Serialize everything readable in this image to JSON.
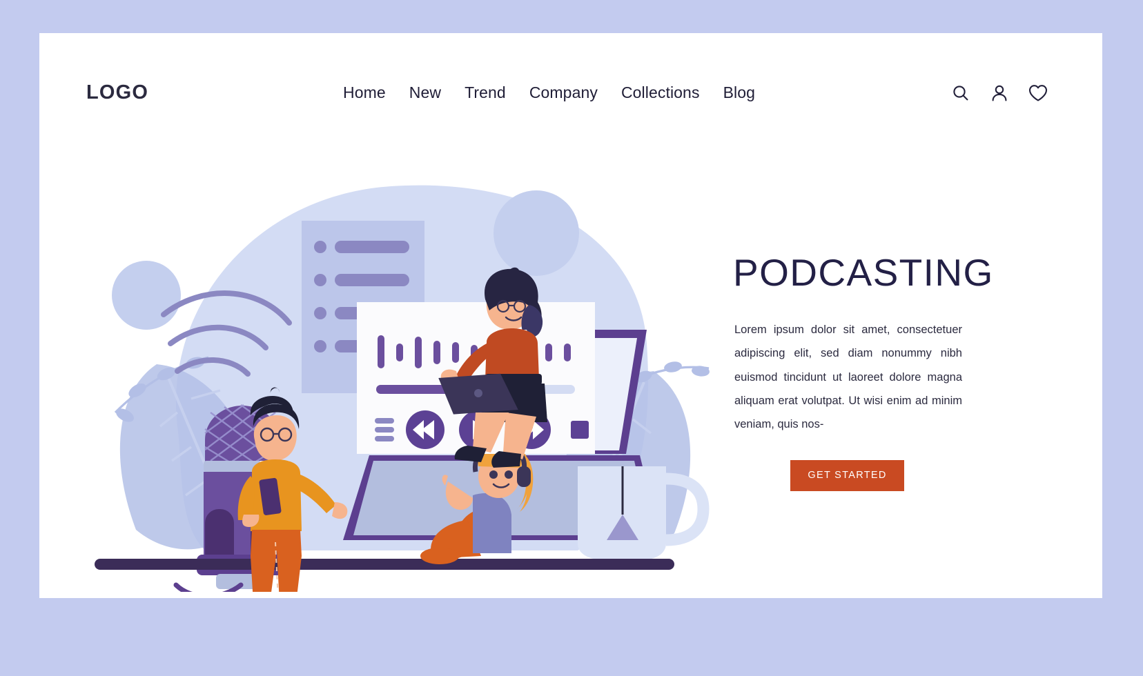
{
  "page": {
    "background_color": "#c3cbef",
    "card_color": "#ffffff"
  },
  "header": {
    "logo": "LOGO",
    "nav": [
      {
        "label": "Home"
      },
      {
        "label": "New"
      },
      {
        "label": "Trend"
      },
      {
        "label": "Company"
      },
      {
        "label": "Collections"
      },
      {
        "label": "Blog"
      }
    ],
    "icons": [
      {
        "name": "search-icon"
      },
      {
        "name": "user-icon"
      },
      {
        "name": "heart-icon"
      }
    ]
  },
  "hero": {
    "title": "PODCASTING",
    "paragraph": "Lorem ipsum dolor sit amet, consectetuer adipiscing elit, sed diam nonummy nibh euismod tincidunt ut laoreet dolore magna aliquam erat volutpat. Ut wisi enim ad minim veniam, quis nos-",
    "cta_label": "GET STARTED",
    "cta_color": "#c94a22",
    "title_color": "#232046"
  },
  "illustration": {
    "alt": "podcasting-illustration",
    "player": {
      "waveform_bars": [
        46,
        24,
        44,
        34,
        30,
        22,
        42,
        30,
        36,
        26
      ],
      "progress_percent": 72,
      "controls": [
        {
          "name": "playlist-icon"
        },
        {
          "name": "rewind-button"
        },
        {
          "name": "play-button"
        },
        {
          "name": "forward-button"
        },
        {
          "name": "stop-button"
        }
      ]
    },
    "list_panel_rows": 4,
    "colors": {
      "purple_dark": "#4b3070",
      "purple": "#5e4290",
      "purple_mid": "#6b4f9e",
      "lavender": "#8f8cc4",
      "light_blue": "#d7e0f5",
      "mid_blue": "#b7c2e8",
      "orange": "#d9611f",
      "skin": "#f6b48e"
    }
  }
}
